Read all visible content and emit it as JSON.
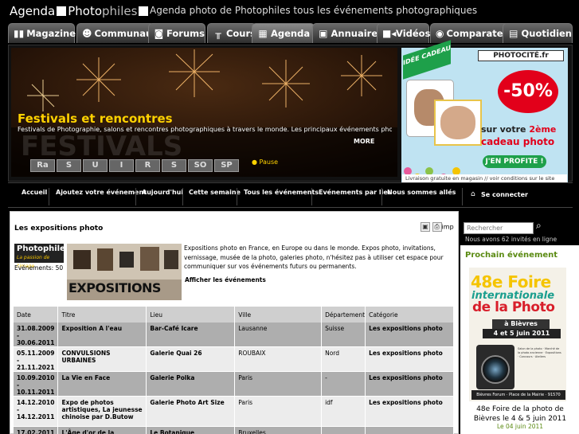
{
  "header": {
    "logo": {
      "part1": "Agenda",
      "part2": "Photo",
      "part3": "philes"
    },
    "tagline": "Agenda photo de Photophiles tous les événements photographiques"
  },
  "nav": {
    "tabs": [
      {
        "label": "Magazine",
        "icon": "book-icon"
      },
      {
        "label": "Communauté",
        "icon": "people-icon"
      },
      {
        "label": "Forums",
        "icon": "chat-bubble-icon"
      },
      {
        "label": "Cours",
        "icon": "tripod-icon"
      },
      {
        "label": "Agenda",
        "icon": "calendar-icon",
        "active": true
      },
      {
        "label": "Annuaires",
        "icon": "building-icon"
      },
      {
        "label": "Vidéos",
        "icon": "video-camera-icon"
      },
      {
        "label": "Comparateur",
        "icon": "camera-icon"
      },
      {
        "label": "Quotidien",
        "icon": "newspaper-icon"
      }
    ]
  },
  "slideshow": {
    "title": "Festivals et rencontres",
    "description": "Festivals de Photographie, salons et rencontres photographiques à travers le monde. Les principaux événements photo à ne pas rater",
    "more_label": "MORE",
    "pause_label": "Pause",
    "thumbs": [
      "Ra",
      "S",
      "U",
      "I",
      "R",
      "S",
      "SO",
      "SP"
    ]
  },
  "ad": {
    "ribbon": "IDÉE CADEAU",
    "brand": "PHOTOCITÉ.fr",
    "discount": "-50%",
    "line1_prefix": "sur votre ",
    "line1_highlight": "2ème",
    "line2": "cadeau photo",
    "cta": "J'EN PROFITE !",
    "footer": "Livraison gratuite en magasin  //  voir conditions sur le site"
  },
  "subnav": {
    "items": [
      "Accueil",
      "Ajoutez votre événement",
      "Aujourd'hui",
      "Cette semaine",
      "Tous les événements",
      "Evénements par lieu",
      "Nous sommes allés"
    ],
    "connect_label": "Se connecter"
  },
  "main": {
    "title": "Les expositions photo",
    "tools_label": "imp",
    "logo_text": "Photophiles",
    "logo_sub": "La passion de l'image",
    "events_count": "Evénements: 50",
    "image_label": "EXPOSITIONS",
    "intro": "Expositions photo en France, en Europe ou dans le monde. Expos photo, invitations, vernissage, musée de la photo, galeries photo, n'hésitez pas à utiliser cet espace pour communiquer sur vos événements futurs ou permanents.",
    "show_events": "Afficher les événements",
    "table": {
      "headers": [
        "Date",
        "Titre",
        "Lieu",
        "Ville",
        "Département",
        "Catégorie"
      ],
      "rows": [
        [
          "31.08.2009 - 30.06.2011",
          "Exposition A l'eau",
          "Bar-Café Icare",
          "Lausanne",
          "Suisse",
          "Les expositions photo"
        ],
        [
          "05.11.2009 - 21.11.2021",
          "CONVULSIONS URBAINES",
          "Galerie Quai 26",
          "ROUBAIX",
          "Nord",
          "Les expositions photo"
        ],
        [
          "10.09.2010 - 10.11.2011",
          "La Vie en Face",
          "Galerie Polka",
          "Paris",
          "-",
          "Les expositions photo"
        ],
        [
          "14.12.2010 - 14.12.2011",
          "Expo de photos artistiques, La jeunesse chinoise par D.Butow",
          "Galerie Photo Art Size",
          "Paris",
          "idf",
          "Les expositions photo"
        ],
        [
          "17.02.2011 -",
          "L'Âge d'or de la",
          "Le Botanique",
          "Bruxelles",
          "",
          ""
        ]
      ]
    }
  },
  "sidebar": {
    "search_placeholder": "Rechercher",
    "online": "Nous avons 62 invités en ligne",
    "next_event_title": "Prochain événement",
    "poster": {
      "line1": "48e Foire",
      "line2": "internationale",
      "line3": "de la Photo",
      "bievres": "à Bièvres",
      "dates": "4 et 5 juin 2011",
      "small_text": "Salon de la photo · Marché de la photo ancienne · Expositions · Concours · Ateliers",
      "url": "Bièvres Forum · Place de la Mairie · 91570 Bièvres · www.foirephoto-bievres.com"
    },
    "caption": "48e Foire de la photo de Bièvres le 4 & 5 juin 2011",
    "date": "Le 04 juin 2011"
  }
}
